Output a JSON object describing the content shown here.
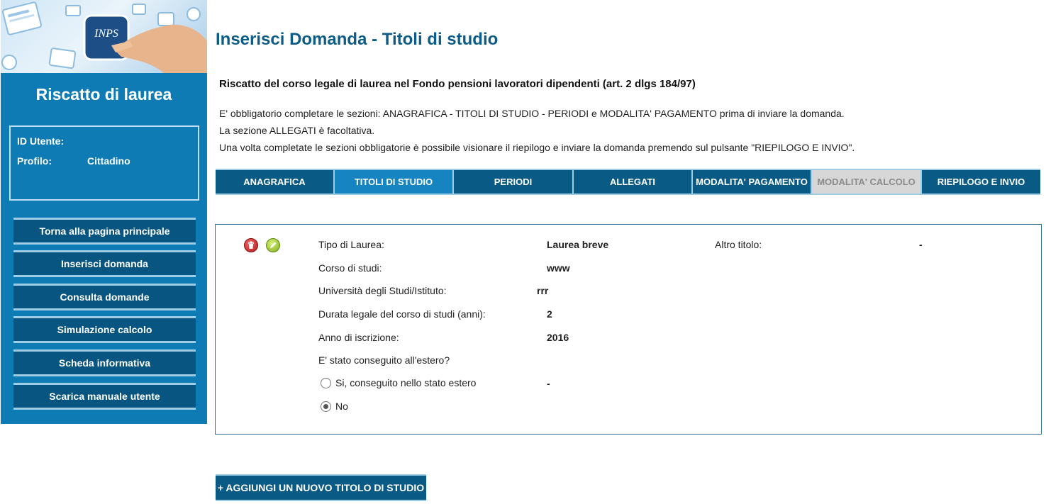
{
  "sidebar": {
    "title": "Riscatto di laurea",
    "user_id_label": "ID Utente:",
    "user_id_value": "",
    "profile_label": "Profilo:",
    "profile_value": "Cittadino",
    "menu": [
      "Torna alla pagina principale",
      "Inserisci domanda",
      "Consulta domande",
      "Simulazione calcolo",
      "Scheda informativa",
      "Scarica manuale utente"
    ]
  },
  "main": {
    "title": "Inserisci Domanda - Titoli di studio",
    "subtitle": "Riscatto del corso legale di laurea nel Fondo pensioni lavoratori dipendenti (art. 2 dlgs 184/97)",
    "info_lines": [
      "E' obbligatorio completare le sezioni: ANAGRAFICA - TITOLI DI STUDIO - PERIODI e MODALITA' PAGAMENTO prima di inviare la domanda.",
      "La sezione ALLEGATI è facoltativa.",
      "Una volta completate le sezioni obbligatorie è possibile visionare il riepilogo e inviare la domanda premendo sul pulsante \"RIEPILOGO E INVIO\"."
    ],
    "tabs": [
      {
        "label": "ANAGRAFICA",
        "state": "normal"
      },
      {
        "label": "TITOLI DI STUDIO",
        "state": "active"
      },
      {
        "label": "PERIODI",
        "state": "normal"
      },
      {
        "label": "ALLEGATI",
        "state": "normal"
      },
      {
        "label": "MODALITA' PAGAMENTO",
        "state": "normal"
      },
      {
        "label": "MODALITA' CALCOLO",
        "state": "disabled"
      },
      {
        "label": "RIEPILOGO E INVIO",
        "state": "normal"
      }
    ],
    "record": {
      "delete_icon": "trash-icon",
      "edit_icon": "pencil-icon",
      "tipo_label": "Tipo di Laurea:",
      "tipo_value": "Laurea breve",
      "altro_label": "Altro titolo:",
      "altro_value": "-",
      "corso_label": "Corso di studi:",
      "corso_value": "www",
      "universita_label": "Università degli Studi/Istituto:",
      "universita_value": "rrr",
      "durata_label": "Durata legale del corso di studi (anni):",
      "durata_value": "2",
      "anno_label": "Anno di iscrizione:",
      "anno_value": "2016",
      "estero_question": "E' stato conseguito all'estero?",
      "estero_yes_label": "Si, conseguito nello stato estero",
      "estero_yes_value": "-",
      "estero_no_label": "No",
      "estero_selected": "No"
    },
    "add_button": "+ AGGIUNGI UN NUOVO TITOLO DI STUDIO"
  },
  "colors": {
    "sidebar_bg": "#0f7bb5",
    "button_bg": "#0a5a86",
    "active_tab": "#1684c1",
    "title": "#0d5c88",
    "disabled_tab": "#d7d7d7"
  }
}
